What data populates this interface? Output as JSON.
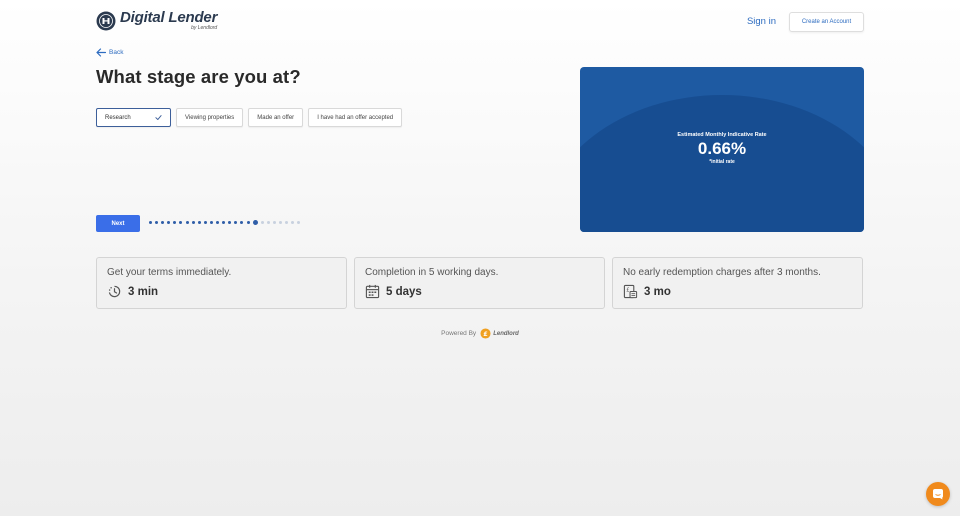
{
  "header": {
    "brand_title": "Digital Lender",
    "brand_subtitle": "by Lendlord",
    "sign_in_label": "Sign in",
    "create_account_label": "Create an Account"
  },
  "back_label": "Back",
  "page_title": "What stage are you at?",
  "stage_options": [
    {
      "label": "Research",
      "selected": true
    },
    {
      "label": "Viewing properties",
      "selected": false
    },
    {
      "label": "Made an offer",
      "selected": false
    },
    {
      "label": "I have had an offer accepted",
      "selected": false
    }
  ],
  "next_label": "Next",
  "progress": {
    "total_steps": 25,
    "current_step": 18
  },
  "rate_card": {
    "label": "Estimated Monthly Indicative Rate",
    "value": "0.66%",
    "note": "*initial rate"
  },
  "features": [
    {
      "title": "Get your terms immediately.",
      "value": "3 min",
      "icon": "clock-icon"
    },
    {
      "title": "Completion in 5 working days.",
      "value": "5 days",
      "icon": "calendar-icon"
    },
    {
      "title": "No early redemption charges after 3 months.",
      "value": "3 mo",
      "icon": "document-pound-icon"
    }
  ],
  "powered_by": {
    "label": "Powered By",
    "brand": "Lendlord"
  },
  "colors": {
    "accent": "#3a6ee8",
    "link": "#2d6cc0",
    "card_blue": "#1e5aa2",
    "card_circle": "#174d91",
    "chat_orange": "#f08a1c"
  }
}
